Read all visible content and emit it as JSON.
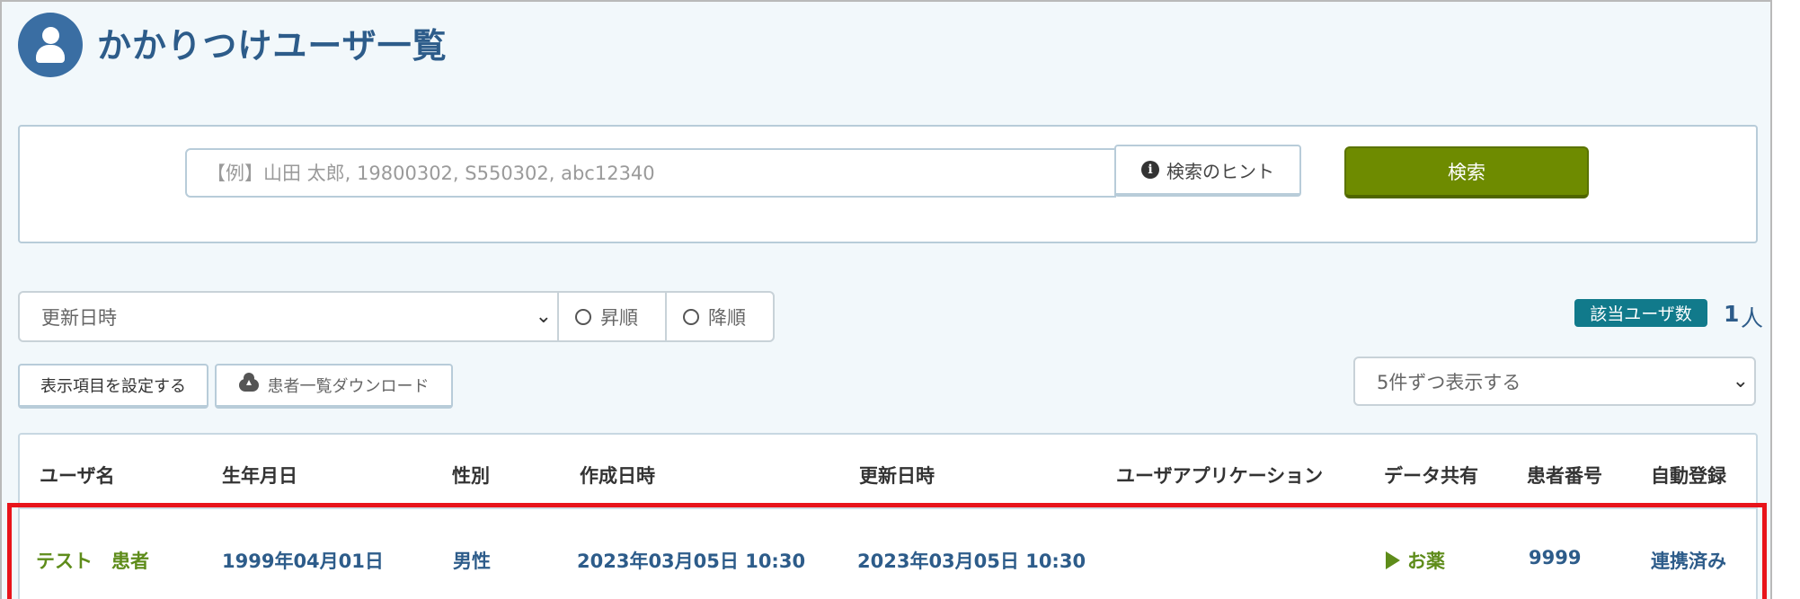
{
  "header": {
    "title": "かかりつけユーザ一覧"
  },
  "search": {
    "placeholder": "【例】山田 太郎, 19800302, S550302, abc12340",
    "hint_label": "検索のヒント",
    "button_label": "検索"
  },
  "sort": {
    "field": "更新日時",
    "asc_label": "昇順",
    "desc_label": "降順"
  },
  "count": {
    "badge": "該当ユーザ数",
    "value": "1",
    "unit": "人"
  },
  "toolbar": {
    "display_settings": "表示項目を設定する",
    "download": "患者一覧ダウンロード",
    "page_size": "5件ずつ表示する"
  },
  "table": {
    "columns": [
      "ユーザ名",
      "生年月日",
      "性別",
      "作成日時",
      "更新日時",
      "ユーザアプリケーション",
      "データ共有",
      "患者番号",
      "自動登録"
    ],
    "rows": [
      {
        "name": "テスト　患者",
        "birth": "1999年04月01日",
        "gender": "男性",
        "created": "2023年03月05日 10:30",
        "updated": "2023年03月05日 10:30",
        "app": "",
        "share": "お薬",
        "patient_no": "9999",
        "auto_reg": "連携済み"
      }
    ]
  },
  "colors": {
    "accent": "#2d5c8a",
    "search_button": "#6e8b00",
    "badge": "#117a8b",
    "highlight": "#e8141b",
    "link_green": "#5e8c1a"
  },
  "icons": {
    "avatar": "user-icon",
    "hint": "info-icon",
    "download": "cloud-download-icon",
    "share": "play-icon"
  }
}
